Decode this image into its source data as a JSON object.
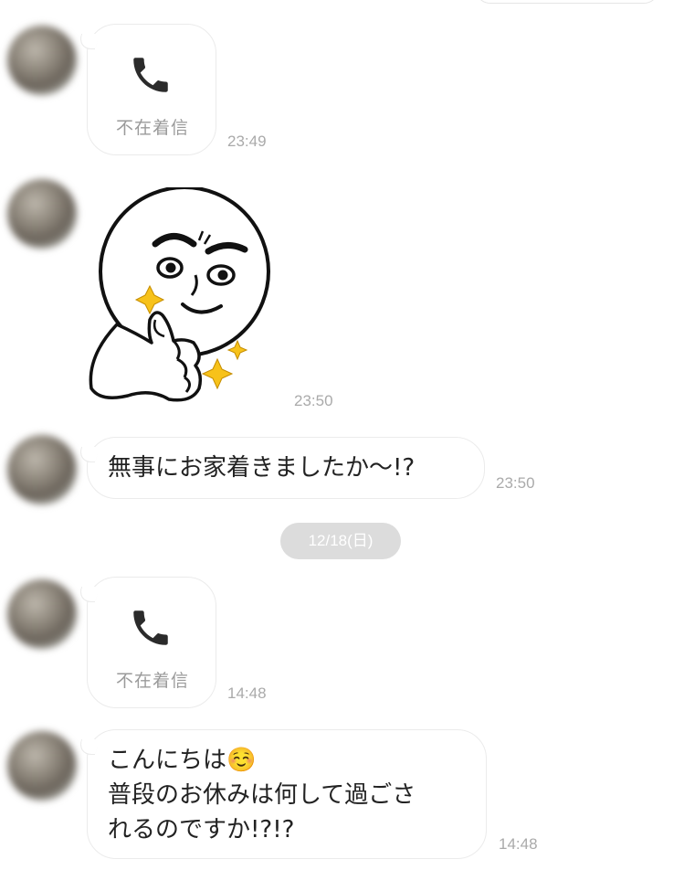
{
  "messages": [
    {
      "type": "missed_call",
      "label": "不在着信",
      "time": "23:49"
    },
    {
      "type": "sticker",
      "time": "23:50"
    },
    {
      "type": "text",
      "text": "無事にお家着きましたか〜!?",
      "time": "23:50"
    },
    {
      "type": "date_separator",
      "label": "12/18(日)"
    },
    {
      "type": "missed_call",
      "label": "不在着信",
      "time": "14:48"
    },
    {
      "type": "text",
      "text": "こんにちは☺️\n普段のお休みは何して過ごさ\nれるのですか!?!?",
      "time": "14:48"
    }
  ],
  "icons": {
    "call": "phone-icon",
    "sticker": "thumbs-up-moon-sticker",
    "emoji": "smiling-face-emoji"
  },
  "colors": {
    "bubble_border": "#ebebeb",
    "timestamp": "#aaaaaa",
    "date_pill": "#dcdcdc"
  }
}
